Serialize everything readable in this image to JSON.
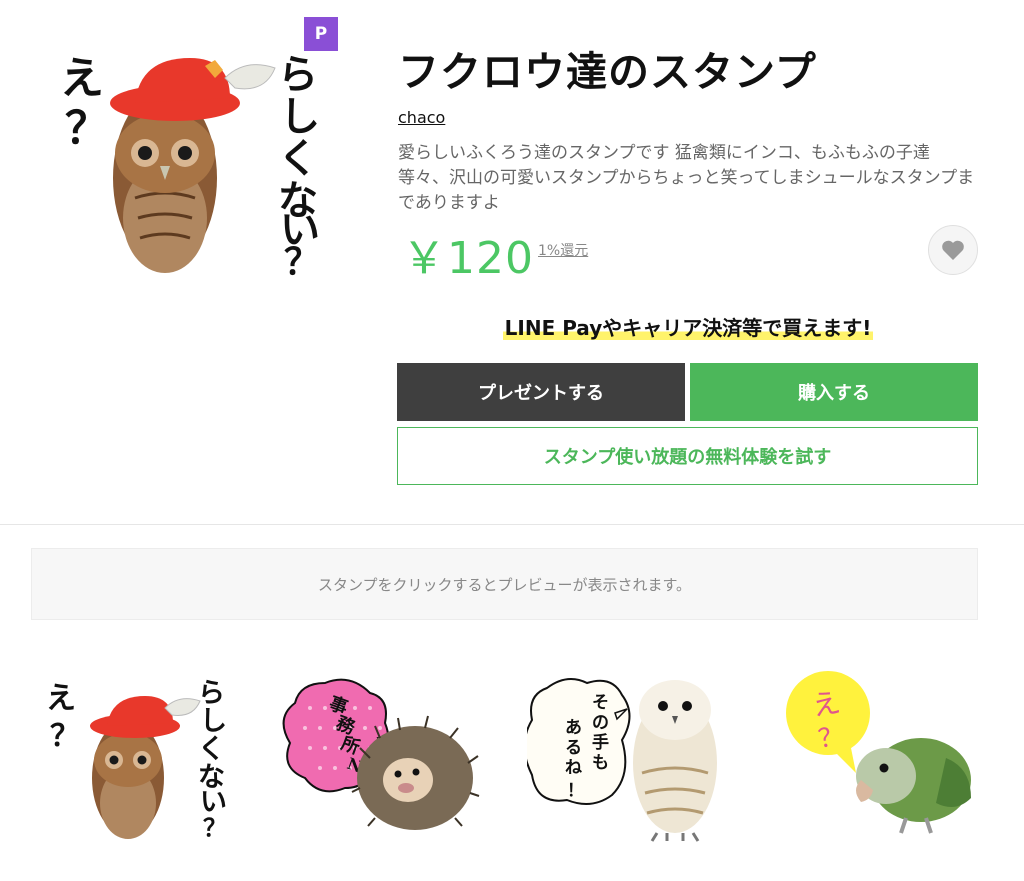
{
  "product": {
    "title": "フクロウ達のスタンプ",
    "author": "chaco",
    "description": "愛らしいふくろう達のスタンプです 猛禽類にインコ、もふもふの子達等々、沢山の可愛いスタンプからちょっと笑ってしまシュールなスタンプまでありますよ",
    "price": "￥120",
    "rebate": "1%還元",
    "badge": "P",
    "main_image_text": {
      "left": "え？",
      "right": "らしくない？"
    }
  },
  "payment_note": "LINE Payやキャリア決済等で買えます!",
  "buttons": {
    "gift": "プレゼントする",
    "buy": "購入する",
    "trial": "スタンプ使い放題の無料体験を試す"
  },
  "preview_hint": "スタンプをクリックするとプレビューが表示されます。",
  "stickers": [
    {
      "left": "え？",
      "right": "らしくない？",
      "subject": "owl-with-red-hat"
    },
    {
      "bubble": "事務所NG",
      "subject": "hedgehog"
    },
    {
      "bubble_line1": "その手も",
      "bubble_line2": "あるね！",
      "subject": "white-owl"
    },
    {
      "bubble": "え？",
      "subject": "green-parakeet"
    }
  ],
  "colors": {
    "accent_green": "#4cb75a",
    "price_green": "#4cc764",
    "badge_purple": "#8a4fd6",
    "gift_button": "#3f3f3f",
    "highlight_yellow": "#fff36b"
  },
  "icons": {
    "favorite": "heart-icon",
    "premium_badge": "p-badge-icon"
  }
}
